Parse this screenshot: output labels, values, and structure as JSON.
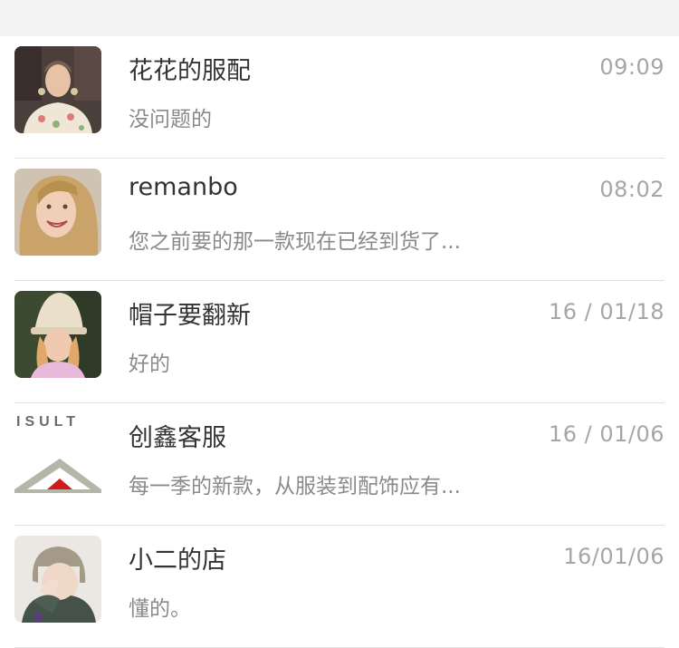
{
  "conversations": [
    {
      "name": "花花的服配",
      "time": "09:09",
      "preview": "没问题的",
      "avatar_icon": "woman-model-avatar"
    },
    {
      "name": "remanbo",
      "time": "08:02",
      "preview": "您之前要的那一款现在已经到货了...",
      "avatar_icon": "smiling-woman-avatar"
    },
    {
      "name": "帽子要翻新",
      "time": "16 / 01/18",
      "preview": "好的",
      "avatar_icon": "girl-with-hat-avatar"
    },
    {
      "name": "创鑫客服",
      "time": "16 / 01/06",
      "preview": "每一季的新款，从服装到配饰应有...",
      "avatar_icon": "consult-logo-avatar",
      "avatar_text": "ISULT"
    },
    {
      "name": "小二的店",
      "time": "16/01/06",
      "preview": "懂的。",
      "avatar_icon": "girl-sweater-avatar"
    }
  ]
}
